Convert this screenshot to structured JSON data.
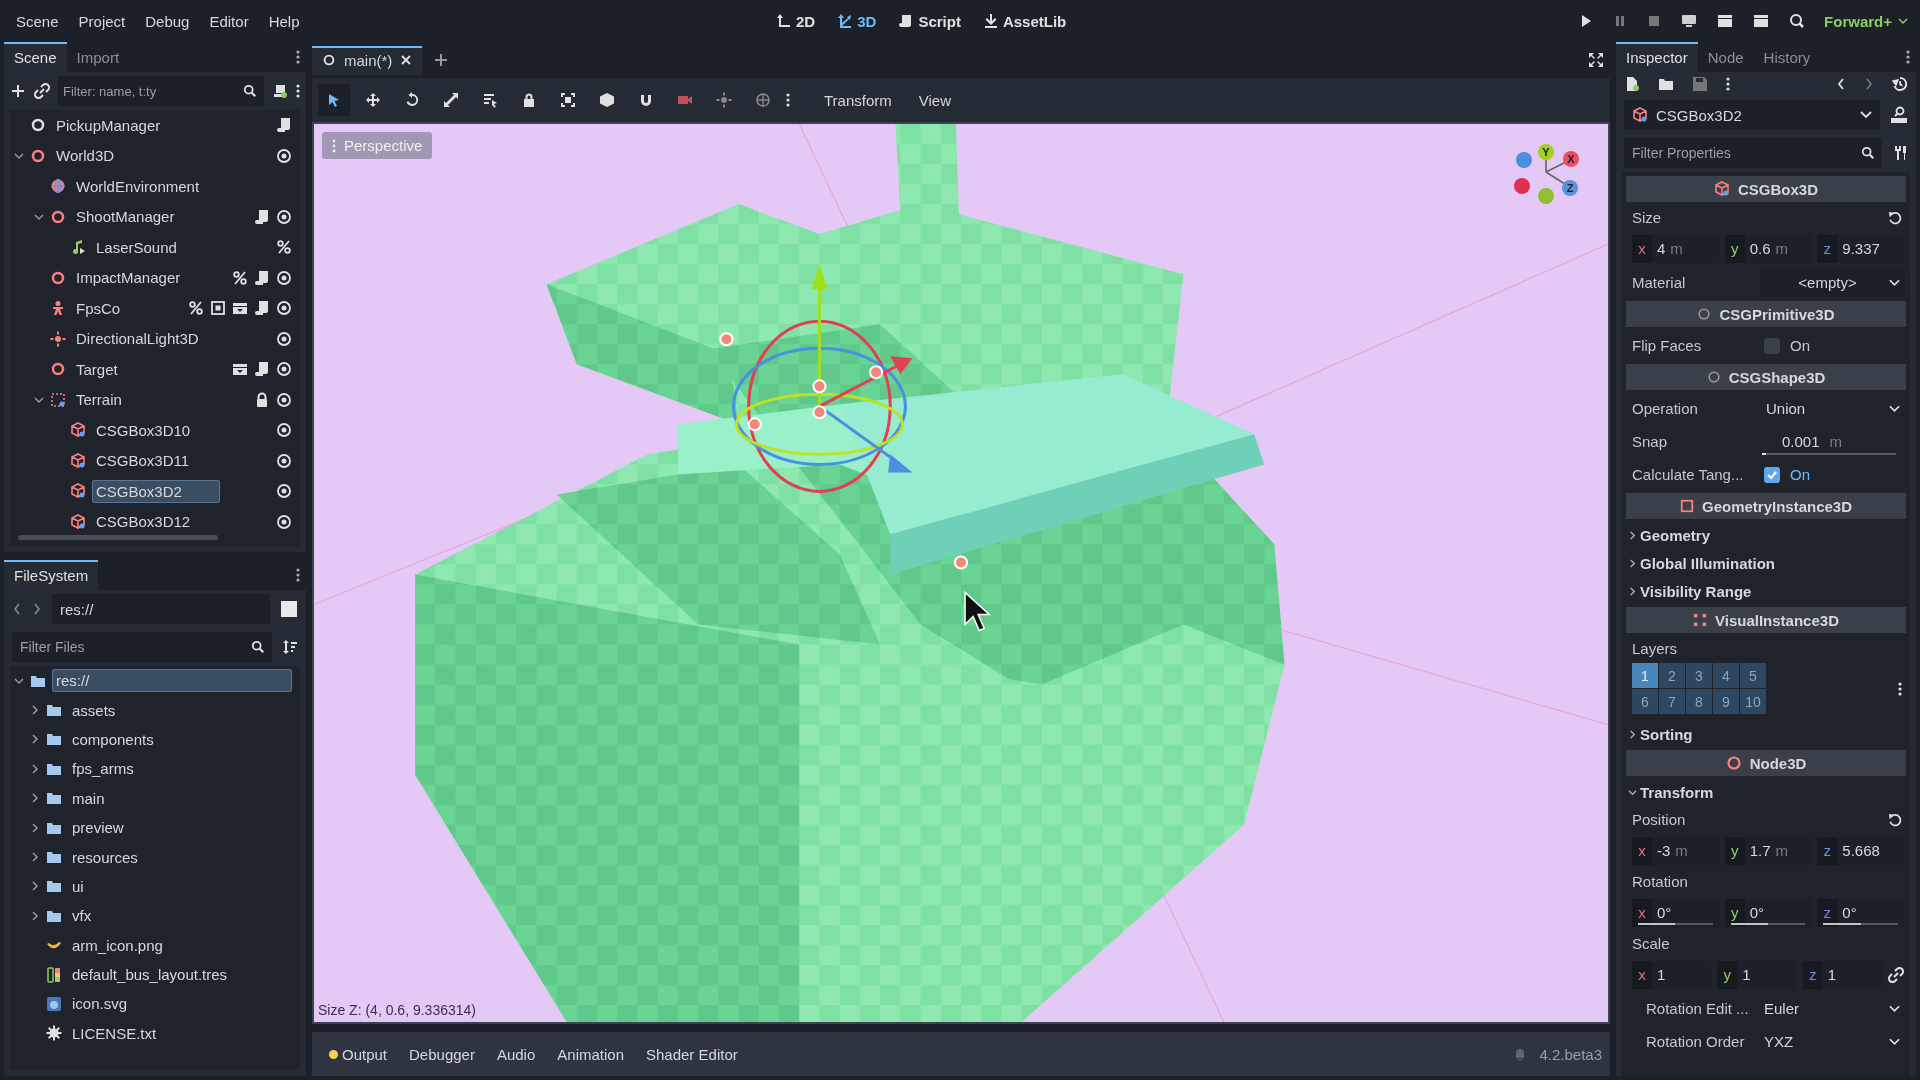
{
  "menu": [
    "Scene",
    "Project",
    "Debug",
    "Editor",
    "Help"
  ],
  "workspaces": [
    {
      "label": "2D",
      "kind": "planar",
      "selected": false
    },
    {
      "label": "3D",
      "kind": "spatial",
      "selected": true
    },
    {
      "label": "Script",
      "kind": "script",
      "selected": false
    },
    {
      "label": "AssetLib",
      "kind": "assetlib",
      "selected": false
    }
  ],
  "renderer": "Forward+",
  "scene_dock": {
    "tabs": [
      {
        "label": "Scene",
        "selected": true
      },
      {
        "label": "Import",
        "selected": false
      }
    ],
    "filter": {
      "placeholder": "Filter: name, t:ty"
    },
    "tree": [
      {
        "name": "PickupManager",
        "kind": "node",
        "selected": false,
        "unique": false,
        "group": false,
        "scene": false,
        "script": true,
        "locked": false
      },
      {
        "name": "World3D",
        "kind": "node3d",
        "selected": false,
        "expanded": true,
        "visible": true,
        "unique": false,
        "group": false,
        "scene": false,
        "script": false,
        "locked": false,
        "children": [
          {
            "name": "WorldEnvironment",
            "kind": "environment",
            "selected": false,
            "unique": false,
            "group": false,
            "scene": false,
            "script": false,
            "locked": false
          },
          {
            "name": "ShootManager",
            "kind": "node3d",
            "selected": false,
            "expanded": true,
            "visible": true,
            "unique": false,
            "group": false,
            "scene": false,
            "script": true,
            "locked": false,
            "children": [
              {
                "name": "LaserSound",
                "kind": "audio",
                "selected": false,
                "unique": true,
                "group": false,
                "scene": false,
                "script": false,
                "locked": false
              }
            ]
          },
          {
            "name": "ImpactManager",
            "kind": "node3d",
            "selected": false,
            "visible": true,
            "unique": true,
            "group": false,
            "scene": false,
            "script": true,
            "locked": false
          },
          {
            "name": "FpsCo",
            "kind": "character",
            "selected": false,
            "visible": true,
            "unique": true,
            "group": true,
            "scene": true,
            "script": true,
            "locked": false
          },
          {
            "name": "DirectionalLight3D",
            "kind": "light",
            "selected": false,
            "visible": true,
            "unique": false,
            "group": false,
            "scene": false,
            "script": false,
            "locked": false
          },
          {
            "name": "Target",
            "kind": "node3d",
            "selected": false,
            "visible": true,
            "unique": false,
            "group": false,
            "scene": true,
            "script": true,
            "locked": false
          },
          {
            "name": "Terrain",
            "kind": "combiner",
            "selected": false,
            "expanded": true,
            "visible": true,
            "unique": false,
            "group": false,
            "scene": false,
            "script": false,
            "locked": true,
            "children": [
              {
                "name": "CSGBox3D10",
                "kind": "box",
                "selected": false,
                "visible": true,
                "unique": false,
                "group": false,
                "scene": false,
                "script": false,
                "locked": false
              },
              {
                "name": "CSGBox3D11",
                "kind": "box",
                "selected": false,
                "visible": true,
                "unique": false,
                "group": false,
                "scene": false,
                "script": false,
                "locked": false
              },
              {
                "name": "CSGBox3D2",
                "kind": "box",
                "selected": true,
                "visible": true,
                "unique": false,
                "group": false,
                "scene": false,
                "script": false,
                "locked": false
              },
              {
                "name": "CSGBox3D12",
                "kind": "box",
                "selected": false,
                "visible": true,
                "unique": false,
                "group": false,
                "scene": false,
                "script": false,
                "locked": false
              }
            ]
          }
        ]
      }
    ]
  },
  "filesystem": {
    "tabs": [
      {
        "label": "FileSystem",
        "selected": true
      }
    ],
    "path": "res://",
    "filter": {
      "placeholder": "Filter Files"
    },
    "tree": [
      {
        "name": "res://",
        "kind": "folder",
        "selected": true,
        "expanded": true,
        "children": [
          {
            "name": "assets",
            "kind": "folder",
            "selected": false,
            "expanded": false
          },
          {
            "name": "components",
            "kind": "folder",
            "selected": false,
            "expanded": false
          },
          {
            "name": "fps_arms",
            "kind": "folder",
            "selected": false,
            "expanded": false
          },
          {
            "name": "main",
            "kind": "folder",
            "selected": false,
            "expanded": false
          },
          {
            "name": "preview",
            "kind": "folder",
            "selected": false,
            "expanded": false
          },
          {
            "name": "resources",
            "kind": "folder",
            "selected": false,
            "expanded": false
          },
          {
            "name": "ui",
            "kind": "folder",
            "selected": false,
            "expanded": false
          },
          {
            "name": "vfx",
            "kind": "folder",
            "selected": false,
            "expanded": false
          },
          {
            "name": "arm_icon.png",
            "kind": "image",
            "selected": false
          },
          {
            "name": "default_bus_layout.tres",
            "kind": "buslayout",
            "selected": false
          },
          {
            "name": "icon.svg",
            "kind": "svg",
            "selected": false
          },
          {
            "name": "LICENSE.txt",
            "kind": "text",
            "selected": false
          }
        ]
      }
    ]
  },
  "editor": {
    "scene_tab": "main(*)",
    "tools": [
      {
        "kind": "select",
        "selected": true
      },
      {
        "kind": "move",
        "selected": false
      },
      {
        "kind": "rotate",
        "selected": false
      },
      {
        "kind": "scale",
        "selected": false
      },
      {
        "kind": "list",
        "selected": false
      },
      {
        "kind": "lock",
        "selected": false
      },
      {
        "kind": "group",
        "selected": false
      },
      {
        "kind": "cube",
        "selected": false
      },
      {
        "kind": "snap",
        "selected": false
      },
      {
        "kind": "camera",
        "selected": false
      },
      {
        "kind": "sun",
        "selected": false
      },
      {
        "kind": "globe",
        "selected": false
      }
    ],
    "menus": [
      "Transform",
      "View"
    ],
    "viewport": {
      "view_button": "Perspective",
      "axes": [
        "Y",
        "X",
        "Z"
      ],
      "status": "Size Z: (4, 0.6, 9.336314)"
    }
  },
  "bottom_panel": {
    "tabs": [
      {
        "label": "Output",
        "has_messages": true
      },
      {
        "label": "Debugger",
        "has_messages": false
      },
      {
        "label": "Audio",
        "has_messages": false
      },
      {
        "label": "Animation",
        "has_messages": false
      },
      {
        "label": "Shader Editor",
        "has_messages": false
      }
    ],
    "version": "4.2.beta3"
  },
  "inspector": {
    "tabs": [
      {
        "label": "Inspector",
        "selected": true
      },
      {
        "label": "Node",
        "selected": false
      },
      {
        "label": "History",
        "selected": false
      }
    ],
    "object": "CSGBox3D2",
    "filter": {
      "placeholder": "Filter Properties"
    },
    "properties": [
      {
        "kind": "category",
        "title": "CSGBox3D"
      },
      {
        "kind": "vector",
        "label": "Size",
        "revertable": true,
        "components": [
          {
            "axis": "x",
            "value": "4",
            "unit": "m"
          },
          {
            "axis": "y",
            "value": "0.6",
            "unit": "m"
          },
          {
            "axis": "z",
            "value": "9.337"
          }
        ]
      },
      {
        "kind": "dropdown",
        "label": "Material",
        "value": "<empty>",
        "boxed": true
      },
      {
        "kind": "category",
        "title": "CSGPrimitive3D"
      },
      {
        "kind": "checkbox",
        "label": "Flip Faces",
        "checked": false,
        "text": "On"
      },
      {
        "kind": "category",
        "title": "CSGShape3D"
      },
      {
        "kind": "dropdown",
        "label": "Operation",
        "value": "Union",
        "boxed": false
      },
      {
        "kind": "number",
        "label": "Snap",
        "value": "0.001",
        "unit": "m",
        "level": 0.02
      },
      {
        "kind": "checkbox",
        "label": "Calculate Tang...",
        "checked": true,
        "text": "On"
      },
      {
        "kind": "category",
        "title": "GeometryInstance3D"
      },
      {
        "kind": "group",
        "title": "Geometry",
        "expanded": false
      },
      {
        "kind": "group",
        "title": "Global Illumination",
        "expanded": false
      },
      {
        "kind": "group",
        "title": "Visibility Range",
        "expanded": false
      },
      {
        "kind": "category",
        "title": "VisualInstance3D"
      },
      {
        "kind": "layers",
        "label": "Layers",
        "cells": [
          {
            "label": "1",
            "selected": true
          },
          {
            "label": "2",
            "selected": false
          },
          {
            "label": "3",
            "selected": false
          },
          {
            "label": "4",
            "selected": false
          },
          {
            "label": "5",
            "selected": false
          },
          {
            "label": "6",
            "selected": false
          },
          {
            "label": "7",
            "selected": false
          },
          {
            "label": "8",
            "selected": false
          },
          {
            "label": "9",
            "selected": false
          },
          {
            "label": "10",
            "selected": false
          }
        ]
      },
      {
        "kind": "group",
        "title": "Sorting",
        "expanded": false
      },
      {
        "kind": "category",
        "title": "Node3D"
      },
      {
        "kind": "group",
        "title": "Transform",
        "expanded": true,
        "children": [
          {
            "kind": "vector",
            "label": "Position",
            "revertable": true,
            "components": [
              {
                "axis": "x",
                "value": "-3",
                "unit": "m"
              },
              {
                "axis": "y",
                "value": "1.7",
                "unit": "m"
              },
              {
                "axis": "z",
                "value": "5.668"
              }
            ]
          },
          {
            "kind": "vector",
            "label": "Rotation",
            "revertable": false,
            "components": [
              {
                "axis": "x",
                "value": "0°",
                "level": 0.5
              },
              {
                "axis": "y",
                "value": "0°",
                "level": 0.5
              },
              {
                "axis": "z",
                "value": "0°",
                "level": 0.5
              }
            ]
          },
          {
            "kind": "vector",
            "label": "Scale",
            "revertable": false,
            "linked": true,
            "components": [
              {
                "axis": "x",
                "value": "1"
              },
              {
                "axis": "y",
                "value": "1"
              },
              {
                "axis": "z",
                "value": "1"
              }
            ]
          },
          {
            "kind": "dropdown",
            "label": "Rotation Edit ...",
            "value": "Euler",
            "boxed": false
          },
          {
            "kind": "dropdown",
            "label": "Rotation Order",
            "value": "YXZ",
            "boxed": false
          }
        ]
      }
    ]
  }
}
